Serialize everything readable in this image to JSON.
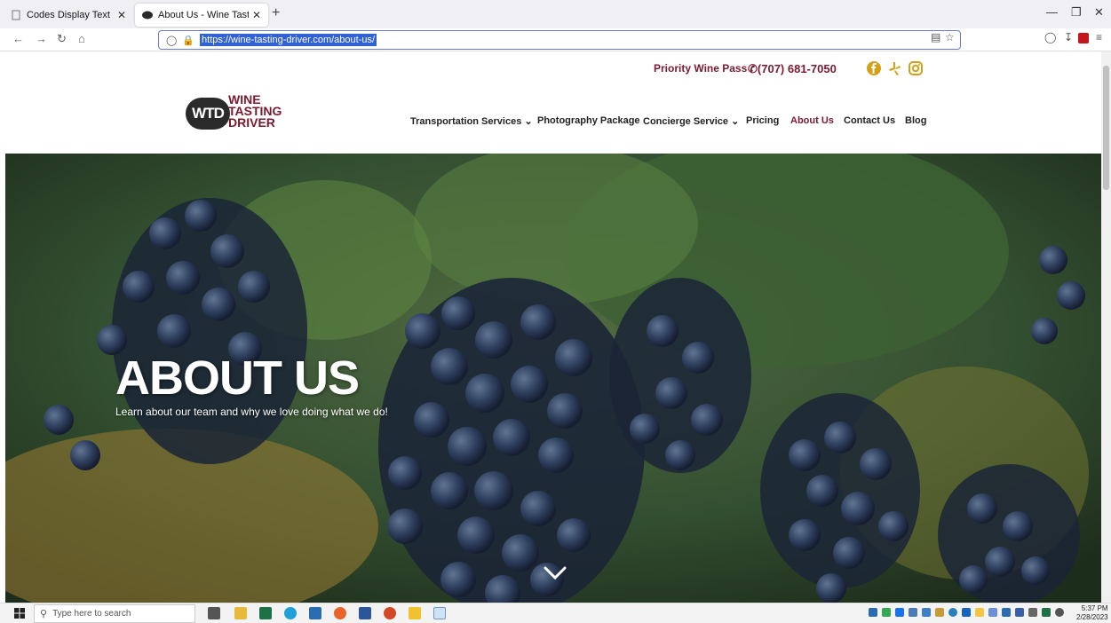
{
  "browser": {
    "tabs": [
      {
        "title": "Codes Display Text",
        "close": "✕"
      },
      {
        "title": "About Us - Wine Tasting Driver",
        "close": "✕"
      }
    ],
    "new_tab": "+",
    "url": "https://wine-tasting-driver.com/about-us/"
  },
  "site": {
    "priority_pass": "Priority Wine Pass",
    "phone": "(707) 681-7050",
    "logo": {
      "badge": "WTD",
      "line1": "WINE",
      "line2": "TASTING",
      "line3": "DRIVER"
    },
    "menu": [
      {
        "label": "Transportation Services",
        "dropdown": "⌄"
      },
      {
        "label": "Photography Package"
      },
      {
        "label": "Concierge Service",
        "dropdown": "⌄"
      },
      {
        "label": "Pricing"
      },
      {
        "label": "About Us"
      },
      {
        "label": "Contact Us"
      },
      {
        "label": "Blog"
      }
    ],
    "hero": {
      "title": "ABOUT US",
      "subtitle": "Learn about our team and why we love doing what we do!"
    }
  },
  "taskbar": {
    "search_placeholder": "Type here to search",
    "time": "5:37 PM",
    "date": "2/28/2023"
  },
  "colors": {
    "brand": "#7a1a2e",
    "accent": "#d4a017",
    "url_highlight": "#3062d6"
  }
}
